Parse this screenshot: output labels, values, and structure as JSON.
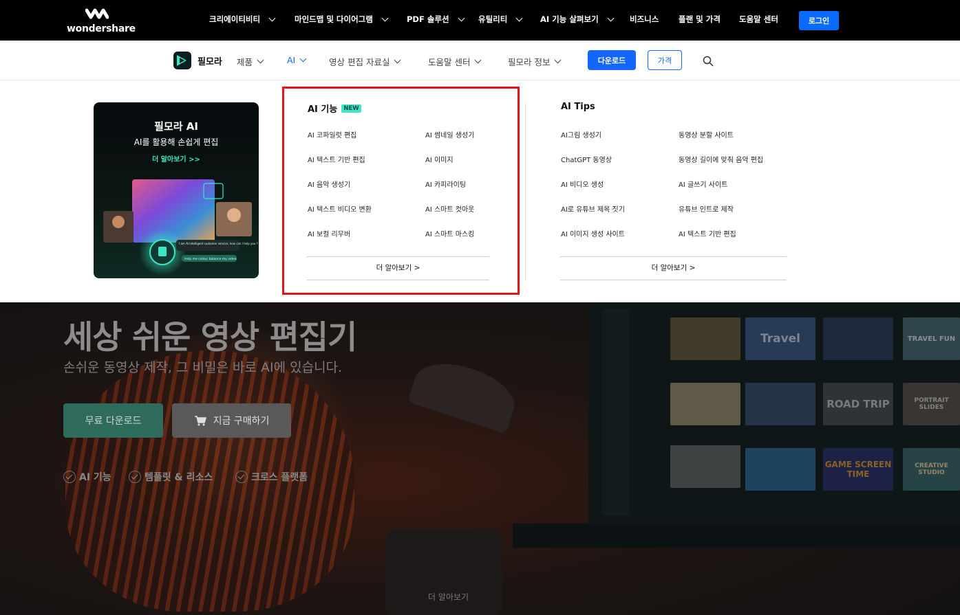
{
  "header": {
    "logo_text": "wondershare",
    "nav": [
      {
        "label": "크리에이티비티"
      },
      {
        "label": "마인드맵 및 다이어그램"
      },
      {
        "label": "PDF 솔루션"
      },
      {
        "label": "유틸리티"
      },
      {
        "label": "AI 기능 살펴보기"
      },
      {
        "label": "비즈니스"
      },
      {
        "label": "플랜 및 가격"
      },
      {
        "label": "도움말 센터"
      }
    ],
    "login_label": "로그인"
  },
  "subnav": {
    "product_name": "필모라",
    "items": [
      {
        "label": "제품"
      },
      {
        "label": "AI"
      },
      {
        "label": "영상 편집 자료실"
      },
      {
        "label": "도움말 센터"
      },
      {
        "label": "필모라 정보"
      }
    ],
    "download_label": "다운로드",
    "price_label": "가격"
  },
  "dropdown": {
    "promo": {
      "title": "필모라 AI",
      "subtitle": "AI를 활용해 손쉽게 편집",
      "link": "더 알아보기 >>",
      "bubble_text": "I am AI Intelligent customer service, how can I help you ?",
      "reply_text": "Help me colour balance my video"
    },
    "ai_features": {
      "title": "AI 기능",
      "badge": "NEW",
      "left": [
        "AI 코파일럿 편집",
        "AI 텍스트 기반 편집",
        "AI 음악 생성기",
        "AI 텍스트 비디오 변환",
        "AI 보컬 리무버"
      ],
      "right": [
        "AI 썸네일 생성기",
        "AI 이미지",
        "AI 카피라이팅",
        "AI 스마트 컷아웃",
        "AI 스마트 마스킹"
      ],
      "more": "더 알아보기 >"
    },
    "ai_tips": {
      "title": "AI Tips",
      "left": [
        "AI그림 생성기",
        "ChatGPT 동영상",
        "AI 비디오 생성",
        "AI로 유튜브 제목 짓기",
        "AI 이미지 생성 사이트"
      ],
      "right": [
        "동영상 분할 사이트",
        "동영상 길이에 맞춰 음악 편집",
        "AI 글쓰기 사이트",
        "유튜브 인트로 제작",
        "AI 텍스트 기반 편집"
      ],
      "more": "더 알아보기 >"
    }
  },
  "hero": {
    "title": "세상 쉬운 영상 편집기",
    "subtitle": "손쉬운 동영상 제작, 그 비밀은 바로 AI에 있습니다.",
    "free_download": "무료 다운로드",
    "buy_now": "지금 구매하기",
    "features": [
      "AI 기능",
      "템플릿 & 리소스",
      "크로스 플랫폼"
    ],
    "learn_more": "더 알아보기",
    "thumbnails": [
      {
        "text": ""
      },
      {
        "text": "Travel"
      },
      {
        "text": ""
      },
      {
        "text": "TRAVEL FUN"
      },
      {
        "text": ""
      },
      {
        "text": ""
      },
      {
        "text": "ROAD TRIP"
      },
      {
        "text": "PORTRAIT SLIDES"
      },
      {
        "text": ""
      },
      {
        "text": ""
      },
      {
        "text": "GAME SCREEN TIME"
      },
      {
        "text": "CREATIVE STUDIO"
      }
    ]
  },
  "colors": {
    "accent_blue": "#1366ff",
    "login_blue": "#0a6cff",
    "teal": "#3ee6c4",
    "highlight_red": "#e8121a",
    "free_download_green": "#2e6b5c"
  },
  "icons": [
    "wondershare-logo-icon",
    "filmora-logo-icon",
    "chevron-down-icon",
    "search-icon",
    "cart-icon",
    "check-circle-icon"
  ]
}
